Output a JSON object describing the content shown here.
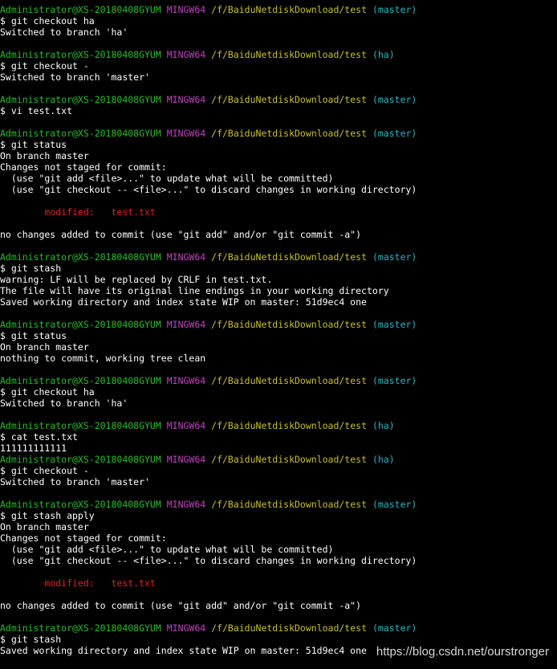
{
  "prompt": {
    "user": "Administrator@XS-20180408GYUM",
    "shell": "MINGW64",
    "path": "/f/BaiduNetdiskDownload/test"
  },
  "lines": [
    {
      "kind": "prompt",
      "branch": "(master)"
    },
    {
      "kind": "text",
      "text": "$ git checkout ha"
    },
    {
      "kind": "text",
      "text": "Switched to branch 'ha'"
    },
    {
      "kind": "blank"
    },
    {
      "kind": "prompt",
      "branch": "(ha)"
    },
    {
      "kind": "text",
      "text": "$ git checkout -"
    },
    {
      "kind": "text",
      "text": "Switched to branch 'master'"
    },
    {
      "kind": "blank"
    },
    {
      "kind": "prompt",
      "branch": "(master)"
    },
    {
      "kind": "text",
      "text": "$ vi test.txt"
    },
    {
      "kind": "blank"
    },
    {
      "kind": "prompt",
      "branch": "(master)"
    },
    {
      "kind": "text",
      "text": "$ git status"
    },
    {
      "kind": "text",
      "text": "On branch master"
    },
    {
      "kind": "text",
      "text": "Changes not staged for commit:"
    },
    {
      "kind": "text",
      "text": "  (use \"git add <file>...\" to update what will be committed)"
    },
    {
      "kind": "text",
      "text": "  (use \"git checkout -- <file>...\" to discard changes in working directory)"
    },
    {
      "kind": "blank"
    },
    {
      "kind": "red",
      "text": "        modified:   test.txt"
    },
    {
      "kind": "blank"
    },
    {
      "kind": "text",
      "text": "no changes added to commit (use \"git add\" and/or \"git commit -a\")"
    },
    {
      "kind": "blank"
    },
    {
      "kind": "prompt",
      "branch": "(master)"
    },
    {
      "kind": "text",
      "text": "$ git stash"
    },
    {
      "kind": "text",
      "text": "warning: LF will be replaced by CRLF in test.txt."
    },
    {
      "kind": "text",
      "text": "The file will have its original line endings in your working directory"
    },
    {
      "kind": "text",
      "text": "Saved working directory and index state WIP on master: 51d9ec4 one"
    },
    {
      "kind": "blank"
    },
    {
      "kind": "prompt",
      "branch": "(master)"
    },
    {
      "kind": "text",
      "text": "$ git status"
    },
    {
      "kind": "text",
      "text": "On branch master"
    },
    {
      "kind": "text",
      "text": "nothing to commit, working tree clean"
    },
    {
      "kind": "blank"
    },
    {
      "kind": "prompt",
      "branch": "(master)"
    },
    {
      "kind": "text",
      "text": "$ git checkout ha"
    },
    {
      "kind": "text",
      "text": "Switched to branch 'ha'"
    },
    {
      "kind": "blank"
    },
    {
      "kind": "prompt",
      "branch": "(ha)"
    },
    {
      "kind": "text",
      "text": "$ cat test.txt"
    },
    {
      "kind": "text",
      "text": "111111111111"
    },
    {
      "kind": "prompt",
      "branch": "(ha)"
    },
    {
      "kind": "text",
      "text": "$ git checkout -"
    },
    {
      "kind": "text",
      "text": "Switched to branch 'master'"
    },
    {
      "kind": "blank"
    },
    {
      "kind": "prompt",
      "branch": "(master)"
    },
    {
      "kind": "text",
      "text": "$ git stash apply"
    },
    {
      "kind": "text",
      "text": "On branch master"
    },
    {
      "kind": "text",
      "text": "Changes not staged for commit:"
    },
    {
      "kind": "text",
      "text": "  (use \"git add <file>...\" to update what will be committed)"
    },
    {
      "kind": "text",
      "text": "  (use \"git checkout -- <file>...\" to discard changes in working directory)"
    },
    {
      "kind": "blank"
    },
    {
      "kind": "red",
      "text": "        modified:   test.txt"
    },
    {
      "kind": "blank"
    },
    {
      "kind": "text",
      "text": "no changes added to commit (use \"git add\" and/or \"git commit -a\")"
    },
    {
      "kind": "blank"
    },
    {
      "kind": "prompt",
      "branch": "(master)"
    },
    {
      "kind": "text",
      "text": "$ git stash"
    },
    {
      "kind": "text",
      "text": "Saved working directory and index state WIP on master: 51d9ec4 one"
    }
  ],
  "watermark": "https://blog.csdn.net/ourstronger",
  "colors": {
    "background": "#000000",
    "user": "#20c020",
    "shell": "#c040c0",
    "path": "#c8c020",
    "branch": "#20b8c8",
    "modified": "#e02020",
    "text": "#ffffff"
  }
}
